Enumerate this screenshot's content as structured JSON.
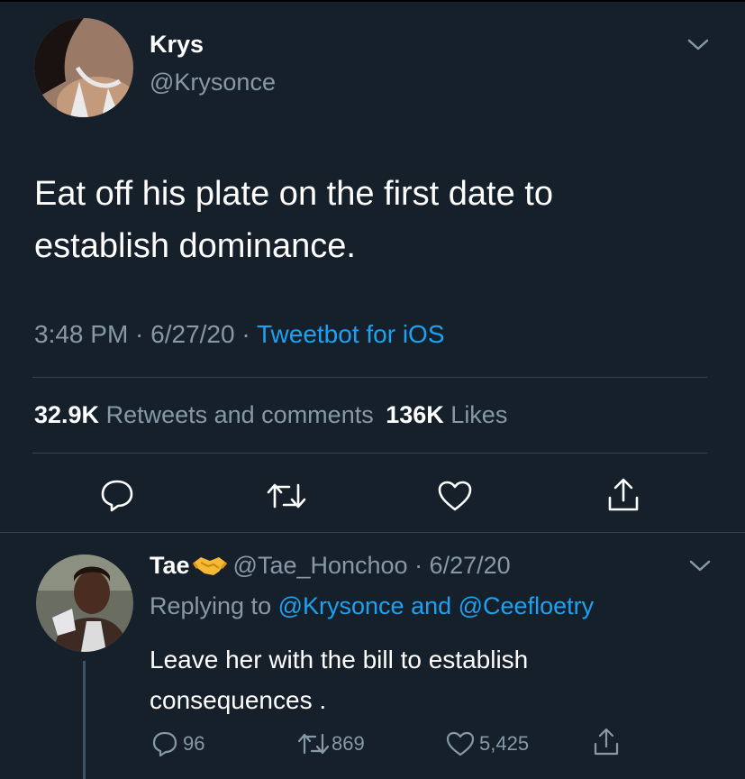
{
  "main_tweet": {
    "display_name": "Krys",
    "handle": "@Krysonce",
    "text_line1": "Eat off his plate on the first date to",
    "text_line2": "establish dominance.",
    "timestamp": "3:48 PM · 6/27/20 · ",
    "source": "Tweetbot for iOS",
    "retweets_count": "32.9K",
    "retweets_label": "Retweets and comments",
    "likes_count": "136K",
    "likes_label": "Likes"
  },
  "reply_tweet": {
    "display_name": "Tae",
    "handle_date": "@Tae_Honchoo · 6/27/20",
    "replying_prefix": "Replying to ",
    "replying_user1": "@Krysonce",
    "replying_and": " and ",
    "replying_user2": "@Ceefloetry",
    "text_line1": "Leave her with the bill to establish",
    "text_line2": "consequences .",
    "reply_count": "96",
    "retweet_count": "869",
    "like_count": "5,425"
  },
  "icons": [
    "chevron-down-icon",
    "reply-icon",
    "retweet-icon",
    "heart-icon",
    "share-icon",
    "handshake-emoji"
  ],
  "colors": {
    "background": "#15202b",
    "muted": "#8899a6",
    "link": "#1da1f2",
    "divider": "#38444d"
  }
}
